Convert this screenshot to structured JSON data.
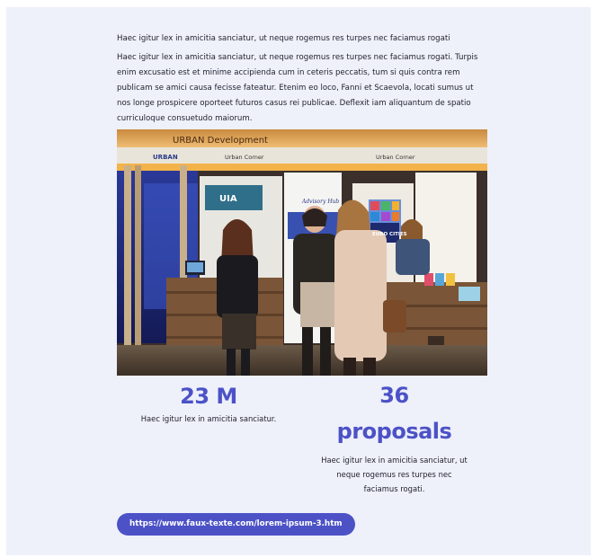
{
  "intro": "Haec igitur lex in amicitia sanciatur, ut neque rogemus res turpes nec faciamus rogati",
  "body": "Haec igitur lex in amicitia sanciatur, ut neque rogemus res turpes nec faciamus rogati. Turpis enim excusatio est et minime accipienda cum in ceteris peccatis, tum si quis contra rem publicam se amici causa fecisse fateatur. Etenim eo loco, Fanni et Scaevola, locati sumus ut nos longe prospicere oporteet futuros casus rei publicae. Deflexit iam aliquantum de spatio curriculoque consuetudo maiorum.",
  "photo": {
    "banner_text": "URBAN Development",
    "sign_urban": "URBAN",
    "sign_corner_left": "Urban Corner",
    "sign_corner_right": "Urban Corner",
    "poster_uia": "UIA",
    "poster_advisory": "Advisory Hub",
    "poster_euro": "EURO CITIES"
  },
  "stats": [
    {
      "value": "23 M",
      "description": "Haec igitur lex in amicitia sanciatur."
    },
    {
      "value": "36",
      "value_line2": "proposals",
      "description": "Haec igitur lex in amicitia sanciatur, ut neque rogemus res turpes nec faciamus rogati."
    }
  ],
  "link": {
    "label": "https://www.faux-texte.com/lorem-ipsum-3.htm"
  },
  "colors": {
    "accent": "#4c52c6",
    "card_bg": "#eef0fa"
  }
}
